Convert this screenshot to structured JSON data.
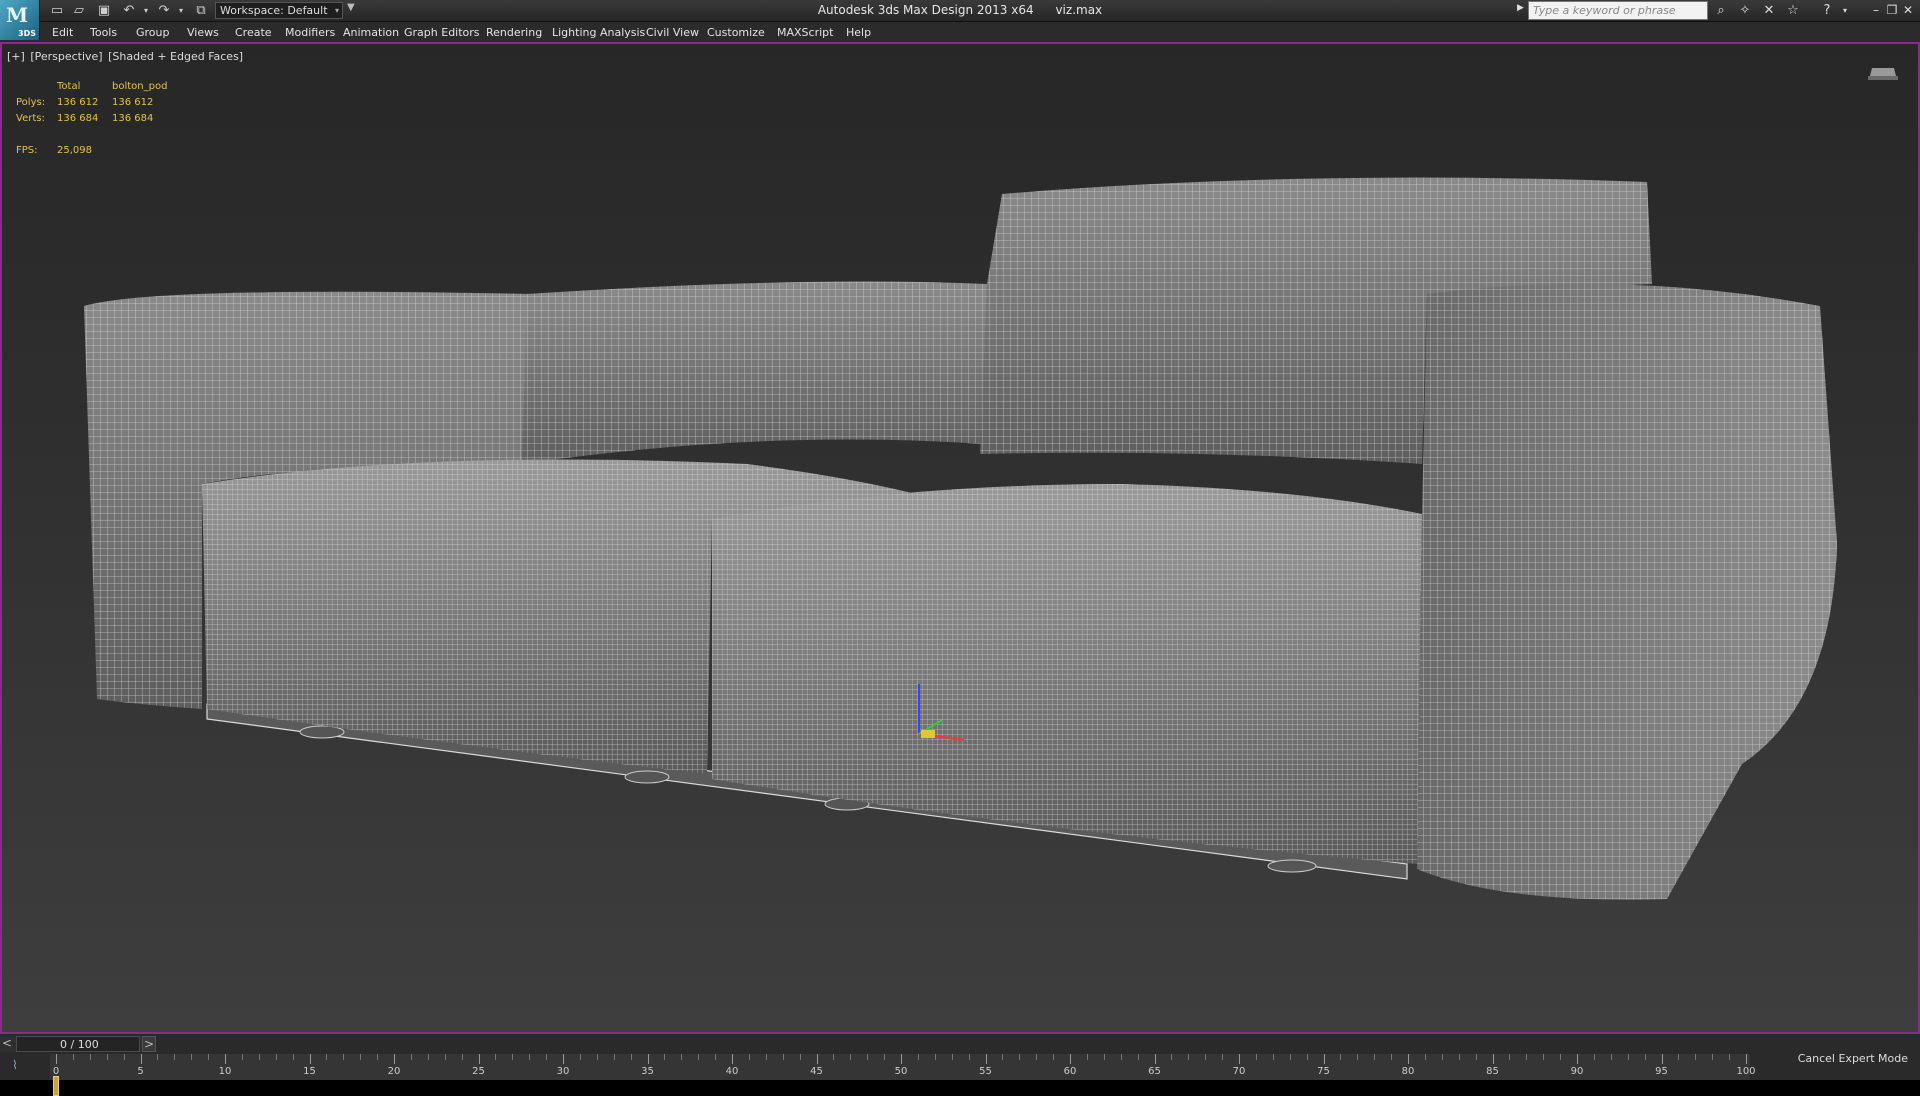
{
  "titlebar": {
    "logo_text": "M",
    "logo_sub": "3DS",
    "app_name": "Autodesk 3ds Max Design 2013 x64",
    "file_name": "viz.max",
    "workspace": "Workspace: Default",
    "search_placeholder": "Type a keyword or phrase"
  },
  "menu": [
    "Edit",
    "Tools",
    "Group",
    "Views",
    "Create",
    "Modifiers",
    "Animation",
    "Graph Editors",
    "Rendering",
    "Lighting Analysis",
    "Civil View",
    "Customize",
    "MAXScript",
    "Help"
  ],
  "viewport": {
    "label_plus": "[+]",
    "label_view": "[Perspective]",
    "label_shading": "[Shaded + Edged Faces]",
    "stats": {
      "col_total": "Total",
      "col_object": "bolton_pod",
      "polys_label": "Polys:",
      "polys_total": "136 612",
      "polys_object": "136 612",
      "verts_label": "Verts:",
      "verts_total": "136 684",
      "verts_object": "136 684",
      "fps_label": "FPS:",
      "fps_value": "25,098"
    }
  },
  "timeline": {
    "frame_label": "0 / 100",
    "prev": "<",
    "next": ">",
    "ticks": [
      "0",
      "5",
      "10",
      "15",
      "20",
      "25",
      "30",
      "35",
      "40",
      "45",
      "50",
      "55",
      "60",
      "65",
      "70",
      "75",
      "80",
      "85",
      "90",
      "95",
      "100"
    ],
    "current_frame": 0,
    "total_frames": 100,
    "cancel_expert": "Cancel Expert Mode"
  },
  "colors": {
    "accent": "#8a2a8c",
    "stats_text": "#e8c040",
    "key_cursor": "#c9a43a"
  }
}
